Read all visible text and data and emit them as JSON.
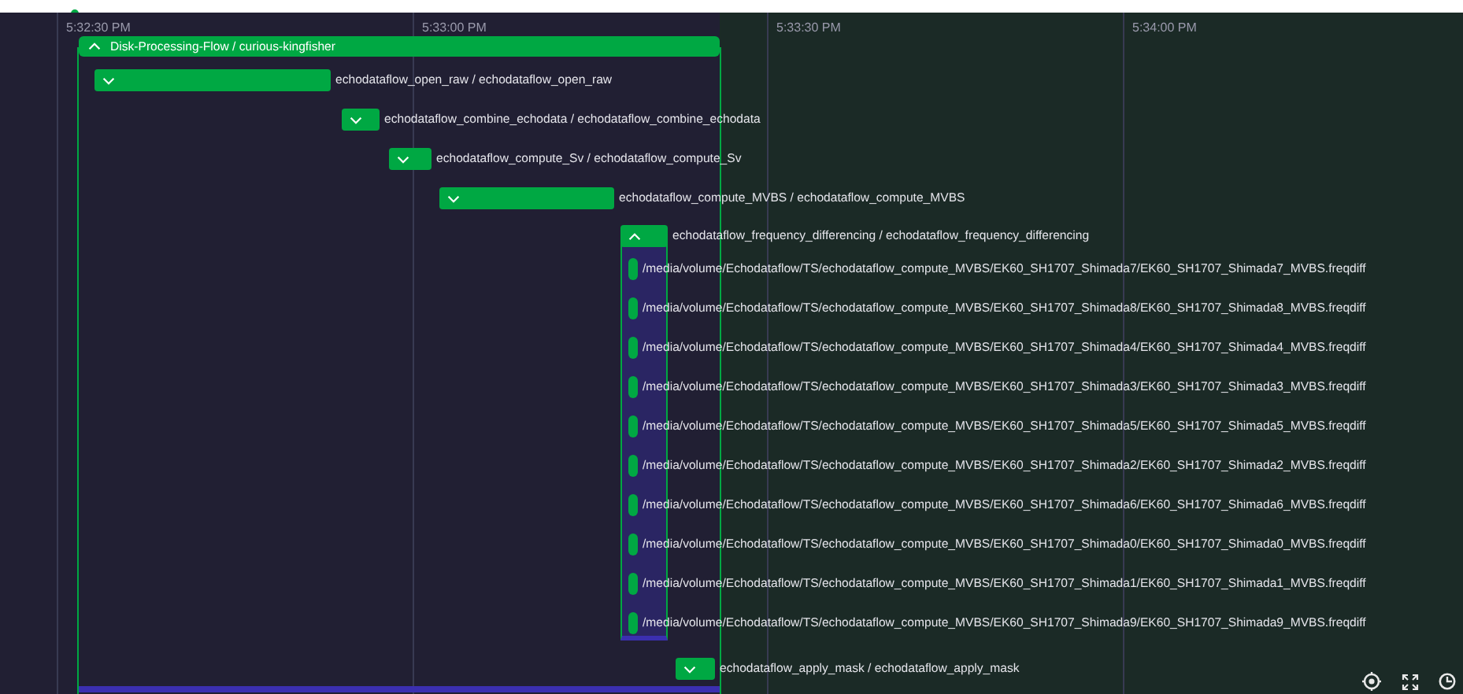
{
  "time_axis": {
    "ticks": [
      "5:32:30 PM",
      "5:33:00 PM",
      "5:33:30 PM",
      "5:34:00 PM"
    ]
  },
  "flow": {
    "label": "Disk-Processing-Flow / curious-kingfisher",
    "expanded": true
  },
  "tasks": [
    {
      "kind": "task",
      "label": "echodataflow_open_raw / echodataflow_open_raw",
      "expanded": false
    },
    {
      "kind": "task",
      "label": "echodataflow_combine_echodata / echodataflow_combine_echodata",
      "expanded": false
    },
    {
      "kind": "task",
      "label": "echodataflow_compute_Sv / echodataflow_compute_Sv",
      "expanded": false
    },
    {
      "kind": "task",
      "label": "echodataflow_compute_MVBS / echodataflow_compute_MVBS",
      "expanded": false
    },
    {
      "kind": "task",
      "label": "echodataflow_frequency_differencing / echodataflow_frequency_differencing",
      "expanded": true
    },
    {
      "kind": "subtask",
      "label": "/media/volume/Echodataflow/TS/echodataflow_compute_MVBS/EK60_SH1707_Shimada7/EK60_SH1707_Shimada7_MVBS.freqdiff"
    },
    {
      "kind": "subtask",
      "label": "/media/volume/Echodataflow/TS/echodataflow_compute_MVBS/EK60_SH1707_Shimada8/EK60_SH1707_Shimada8_MVBS.freqdiff"
    },
    {
      "kind": "subtask",
      "label": "/media/volume/Echodataflow/TS/echodataflow_compute_MVBS/EK60_SH1707_Shimada4/EK60_SH1707_Shimada4_MVBS.freqdiff"
    },
    {
      "kind": "subtask",
      "label": "/media/volume/Echodataflow/TS/echodataflow_compute_MVBS/EK60_SH1707_Shimada3/EK60_SH1707_Shimada3_MVBS.freqdiff"
    },
    {
      "kind": "subtask",
      "label": "/media/volume/Echodataflow/TS/echodataflow_compute_MVBS/EK60_SH1707_Shimada5/EK60_SH1707_Shimada5_MVBS.freqdiff"
    },
    {
      "kind": "subtask",
      "label": "/media/volume/Echodataflow/TS/echodataflow_compute_MVBS/EK60_SH1707_Shimada2/EK60_SH1707_Shimada2_MVBS.freqdiff"
    },
    {
      "kind": "subtask",
      "label": "/media/volume/Echodataflow/TS/echodataflow_compute_MVBS/EK60_SH1707_Shimada6/EK60_SH1707_Shimada6_MVBS.freqdiff"
    },
    {
      "kind": "subtask",
      "label": "/media/volume/Echodataflow/TS/echodataflow_compute_MVBS/EK60_SH1707_Shimada0/EK60_SH1707_Shimada0_MVBS.freqdiff"
    },
    {
      "kind": "subtask",
      "label": "/media/volume/Echodataflow/TS/echodataflow_compute_MVBS/EK60_SH1707_Shimada1/EK60_SH1707_Shimada1_MVBS.freqdiff"
    },
    {
      "kind": "subtask",
      "label": "/media/volume/Echodataflow/TS/echodataflow_compute_MVBS/EK60_SH1707_Shimada9/EK60_SH1707_Shimada9_MVBS.freqdiff"
    },
    {
      "kind": "task",
      "label": "echodataflow_apply_mask / echodataflow_apply_mask",
      "expanded": false
    }
  ]
}
